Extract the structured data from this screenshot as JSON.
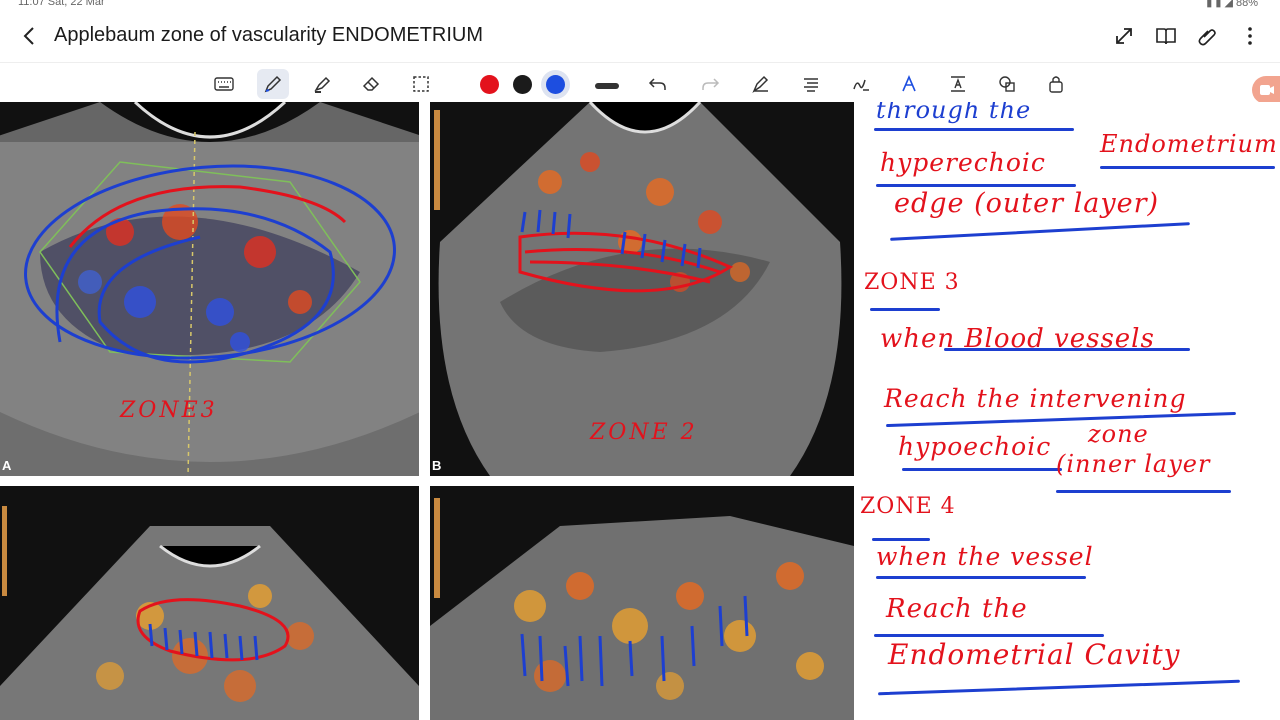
{
  "window": {
    "status_time": "11:07 Sat, 22 Mar",
    "title": "Applebaum zone of vascularity ENDOMETRIUM"
  },
  "toolbar": {
    "tools": [
      "keyboard-icon",
      "pen-icon",
      "highlighter-icon",
      "eraser-icon",
      "lasso-icon"
    ],
    "colors": [
      "#e3121c",
      "#1b1b1b",
      "#1d4ee0"
    ],
    "selected_color": "#1d4ee0"
  },
  "panels": {
    "a": {
      "letter": "A",
      "label": "ZONE3"
    },
    "b": {
      "letter": "B",
      "label": "ZONE 2"
    }
  },
  "notes": {
    "line1": "through the",
    "line2a": "hyperechoic",
    "line2b": "Endometrium",
    "line3": "edge (outer layer)",
    "zone3_title": "ZONE 3",
    "zone3_l1": "when Blood vessels",
    "zone3_l2": "Reach the intervening",
    "zone3_l3a": "hypoechoic",
    "zone3_l3b": "zone",
    "zone3_l4": "(inner layer",
    "zone4_title": "ZONE 4",
    "zone4_l1": "when the vessel",
    "zone4_l2": "Reach the",
    "zone4_l3": "Endometrial Cavity"
  }
}
